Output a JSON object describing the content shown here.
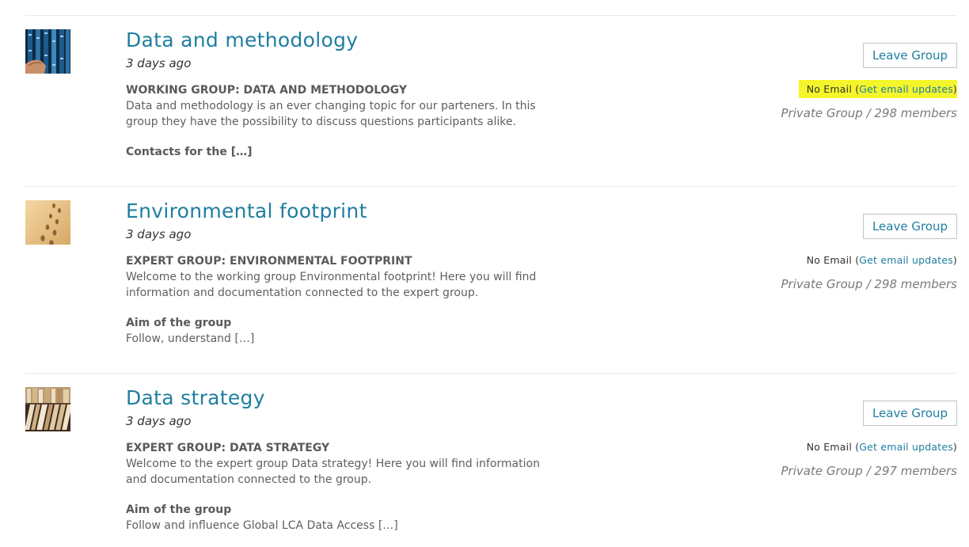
{
  "groups": [
    {
      "title": "Data and methodology",
      "date": "3 days ago",
      "heading": "WORKING GROUP: DATA AND METHODOLOGY",
      "description": "Data and methodology is an ever changing topic for our parteners. In this group they have the possibility to discuss questions participants alike.",
      "subheading": "Contacts for the […]",
      "more": "",
      "leave_label": "Leave Group",
      "email_status": "No Email",
      "email_open": "(",
      "email_link": "Get email updates",
      "email_close": ")",
      "meta": "Private Group / 298 members",
      "thumb_icon": "server-rack-photo"
    },
    {
      "title": "Environmental footprint",
      "date": "3 days ago",
      "heading": "EXPERT GROUP: ENVIRONMENTAL FOOTPRINT",
      "description": "Welcome to the working group Environmental footprint! Here you will find information and documentation connected to the expert group.",
      "subheading": "Aim of the group",
      "more": "Follow, understand […]",
      "leave_label": "Leave Group",
      "email_status": "No Email",
      "email_open": "(",
      "email_link": "Get email updates",
      "email_close": ")",
      "meta": "Private Group / 298 members",
      "thumb_icon": "footprints-in-sand-photo"
    },
    {
      "title": "Data strategy",
      "date": "3 days ago",
      "heading": "EXPERT GROUP: DATA STRATEGY",
      "description": "Welcome to the expert group Data strategy! Here you will find information and documentation connected to the group.",
      "subheading": "Aim of the group",
      "more": "Follow and influence Global LCA Data Access […]",
      "leave_label": "Leave Group",
      "email_status": "No Email",
      "email_open": "(",
      "email_link": "Get email updates",
      "email_close": ")",
      "meta": "Private Group / 297 members",
      "thumb_icon": "archive-files-photo"
    }
  ],
  "colors": {
    "link": "#1f7ea1",
    "highlight": "#f4f52a",
    "divider": "#e9e9e9"
  }
}
